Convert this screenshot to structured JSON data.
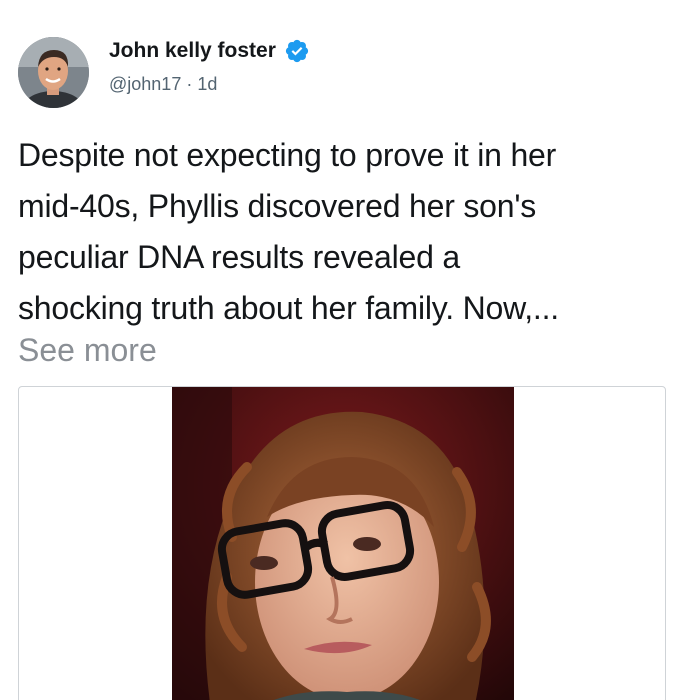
{
  "author": {
    "display_name": "John kelly foster",
    "handle": "@john17",
    "separator": "·",
    "time_ago": "1d",
    "verified": true,
    "verified_color": "#1d9bf0"
  },
  "post": {
    "text_lines": [
      "Despite not expecting to prove it in her",
      "mid-40s, Phyllis discovered her son's",
      "peculiar DNA results revealed a",
      "shocking truth about her family. Now,..."
    ],
    "see_more_label": "See more"
  },
  "colors": {
    "text": "#14171a",
    "muted": "#536471",
    "see_more": "#8a8f95",
    "card_border": "#cfd3d7"
  },
  "icons": {
    "verified": "verified-badge-icon"
  }
}
